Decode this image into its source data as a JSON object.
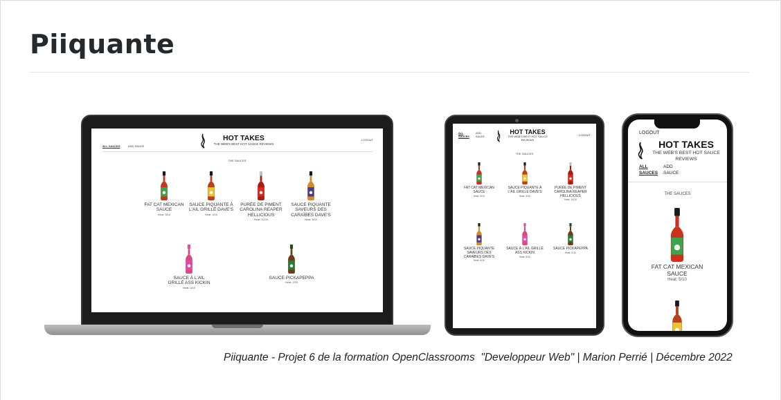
{
  "page": {
    "title": "Piiquante",
    "caption": "Piiquante - Projet 6 de la formation OpenClassrooms  \"Developpeur Web\" | Marion Perrié | Décembre 2022"
  },
  "site": {
    "nav_all": "ALL SAUCES",
    "nav_add": "ADD SAUCE",
    "nav_all_1": "ALL",
    "nav_all_2": "SAUCES",
    "nav_add_1": "ADD",
    "nav_add_2": "SAUCE",
    "logout": "LOGOUT",
    "brand": "HOT TAKES",
    "tagline": "THE WEB'S BEST HOT SAUCE REVIEWS",
    "section": "THE SAUCES"
  },
  "colors": {
    "laptop_body": "#1c1c1c",
    "laptop_base": "#a6a6a6",
    "title": "#24292e"
  },
  "sauces": [
    {
      "name": "FAT CAT MEXICAN SAUCE",
      "heat": "Heat: 5/10",
      "label": "#3fa34d",
      "sauce": "#c8321e",
      "cap": "#1a1a1a"
    },
    {
      "name": "SAUCE PIQUANTE À L'AIL GRILLÉ DAVE'S",
      "heat": "Heat: 4/10",
      "label": "#e8c531",
      "sauce": "#b8421e",
      "cap": "#1a1a1a"
    },
    {
      "name": "PURÉE DE PIMENT CAROLINA REAPER HELLICIOUS",
      "heat": "Heat: 10/10",
      "label": "#d52b1e",
      "sauce": "#a81e14",
      "cap": "#c0c0c0"
    },
    {
      "name": "SAUCE PIQUANTE SAVEURS DES CARAÏBES DAVE'S",
      "heat": "Heat: 6/10",
      "label": "#4b3a8c",
      "sauce": "#d28a2a",
      "cap": "#1a1a1a"
    },
    {
      "name": "SAUCE À L'AIL GRILLÉ ASS KICKIN",
      "heat": "Heat: 5/10",
      "label": "#e04ba8",
      "sauce": "#d84b7e",
      "cap": "#e04ba8"
    },
    {
      "name": "SAUCE PICKAPEPPA",
      "heat": "Heat: 2/10",
      "label": "#2f7a3a",
      "sauce": "#6a3e1a",
      "cap": "#1f4a26"
    }
  ]
}
